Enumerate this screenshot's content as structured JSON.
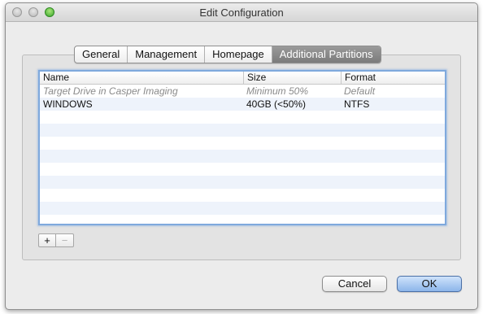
{
  "window": {
    "title": "Edit Configuration"
  },
  "tabs": [
    {
      "label": "General",
      "active": false
    },
    {
      "label": "Management",
      "active": false
    },
    {
      "label": "Homepage",
      "active": false
    },
    {
      "label": "Additional Partitions",
      "active": true
    }
  ],
  "table": {
    "columns": [
      "Name",
      "Size",
      "Format"
    ],
    "rows": [
      {
        "name": "Target Drive in Casper Imaging",
        "size": "Minimum 50%",
        "format": "Default",
        "style": "placeholder"
      },
      {
        "name": "WINDOWS",
        "size": "40GB (<50%)",
        "format": "NTFS",
        "style": "normal"
      }
    ],
    "empty_rows": 9
  },
  "controls": {
    "add_label": "+",
    "remove_label": "−",
    "remove_enabled": false
  },
  "buttons": {
    "cancel": "Cancel",
    "ok": "OK"
  },
  "colors": {
    "accent_focus": "#7fa9dd",
    "zebra": "#eef3fb",
    "active_tab": "#8a8a8a"
  }
}
